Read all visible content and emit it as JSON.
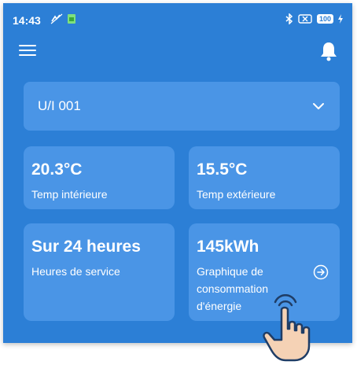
{
  "status_bar": {
    "time": "14:43",
    "battery": "100"
  },
  "device_selector": {
    "selected": "U/I 001"
  },
  "cards": {
    "temp_interior": {
      "value": "20.3°C",
      "label": "Temp intérieure"
    },
    "temp_exterior": {
      "value": "15.5°C",
      "label": "Temp extérieure"
    },
    "service_hours": {
      "value": "Sur 24 heures",
      "label": "Heures de service"
    },
    "energy": {
      "value": "145kWh",
      "label": "Graphique de consommation d'énergie"
    }
  },
  "icons": {
    "menu": "hamburger-menu",
    "notifications": "bell",
    "dropdown": "chevron-down",
    "energy_link": "arrow-right-circle",
    "pointer": "hand-pointer"
  },
  "colors": {
    "background": "#2c7fd6",
    "card": "#4a95e6",
    "text": "#ffffff"
  }
}
